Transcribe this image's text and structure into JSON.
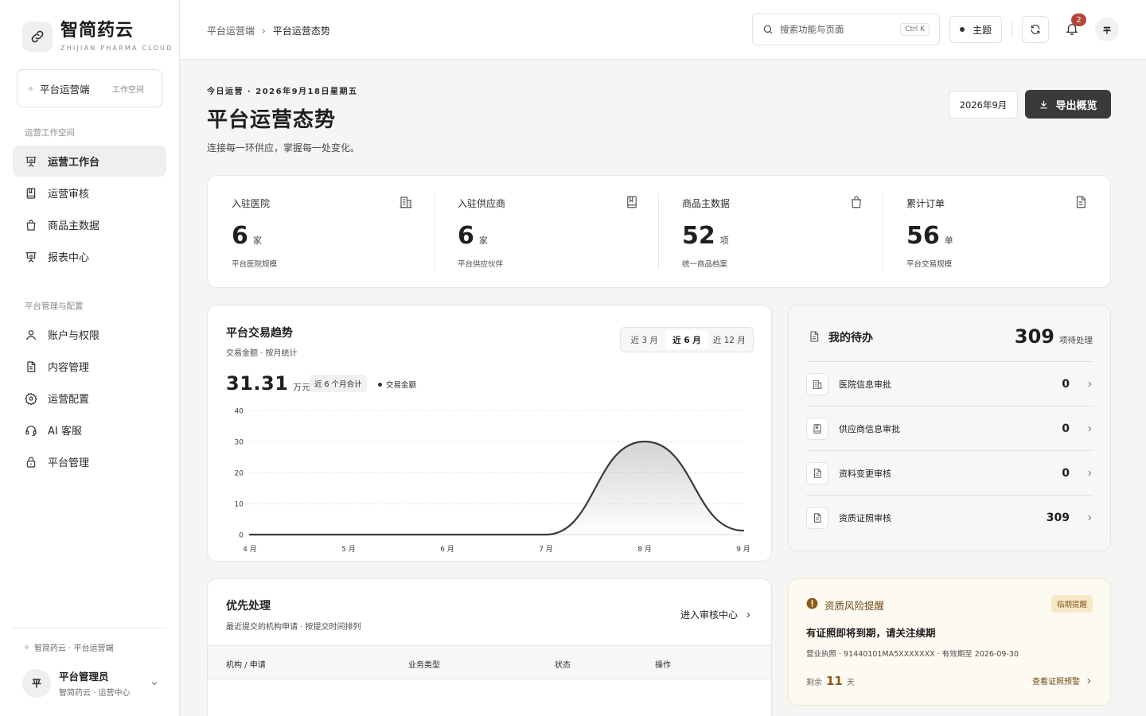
{
  "brand": {
    "name": "智简药云",
    "sub": "ZHIJIAN PHARMA CLOUD"
  },
  "workspace": {
    "label": "平台运营端",
    "tag": "工作空间"
  },
  "nav": {
    "group1": "运营工作空间",
    "group2": "平台管理与配置",
    "items": [
      {
        "label": "运营工作台",
        "icon": "presentation-icon",
        "active": true
      },
      {
        "label": "运营审核",
        "icon": "book-icon"
      },
      {
        "label": "商品主数据",
        "icon": "shopping-bag-icon"
      },
      {
        "label": "报表中心",
        "icon": "presentation-icon"
      },
      {
        "label": "账户与权限",
        "icon": "user-icon"
      },
      {
        "label": "内容管理",
        "icon": "document-icon"
      },
      {
        "label": "运营配置",
        "icon": "gear-icon"
      },
      {
        "label": "AI 客服",
        "icon": "headset-icon"
      },
      {
        "label": "平台管理",
        "icon": "lock-icon"
      }
    ]
  },
  "sidebar_footer": "智简药云 · 平台运营端",
  "user": {
    "avatar": "平",
    "name": "平台管理员",
    "sub": "智简药云 · 运营中心"
  },
  "topbar": {
    "breadcrumb": [
      "平台运营端",
      "平台运营态势"
    ],
    "breadcrumb_sep": "›",
    "search_placeholder": "搜索功能与页面",
    "search_shortcut": "Ctrl K",
    "theme_label": "主题",
    "notification_count": "2",
    "avatar": "平"
  },
  "header": {
    "eyebrow": "今日运营 · 2026年9月18日星期五",
    "title": "平台运营态势",
    "tagline": "连接每一环供应，掌握每一处变化。",
    "month": "2026年9月",
    "export_label": "导出概览"
  },
  "stats": [
    {
      "label": "入驻医院",
      "value": "6",
      "unit": "家",
      "sub": "平台医院规模",
      "icon": "building-icon"
    },
    {
      "label": "入驻供应商",
      "value": "6",
      "unit": "家",
      "sub": "平台供应伙伴",
      "icon": "book-icon"
    },
    {
      "label": "商品主数据",
      "value": "52",
      "unit": "项",
      "sub": "统一商品档案",
      "icon": "shopping-bag-icon"
    },
    {
      "label": "累计订单",
      "value": "56",
      "unit": "单",
      "sub": "平台交易规模",
      "icon": "document-icon"
    }
  ],
  "trend": {
    "title": "平台交易趋势",
    "subtitle": "交易金额 · 按月统计",
    "ranges": [
      "近 3 月",
      "近 6 月",
      "近 12 月"
    ],
    "active_range": 1,
    "total": "31.31",
    "total_unit": "万元",
    "total_tag": "近 6 个月合计",
    "legend": "交易金额"
  },
  "chart_data": {
    "type": "area",
    "x": [
      "4 月",
      "5 月",
      "6 月",
      "7 月",
      "8 月",
      "9 月"
    ],
    "series": [
      {
        "name": "交易金额",
        "values": [
          0,
          0,
          0,
          0,
          30,
          1.3
        ]
      }
    ],
    "ylim": [
      0,
      40
    ],
    "yticks": [
      0,
      10,
      20,
      30,
      40
    ],
    "grid": true,
    "color": "#3a3a3a"
  },
  "todo": {
    "title": "我的待办",
    "count": "309",
    "count_label": "项待处理",
    "items": [
      {
        "label": "医院信息审批",
        "value": "0",
        "icon": "building-icon"
      },
      {
        "label": "供应商信息审批",
        "value": "0",
        "icon": "book-icon"
      },
      {
        "label": "资料变更审核",
        "value": "0",
        "icon": "document-icon"
      },
      {
        "label": "资质证照审核",
        "value": "309",
        "icon": "document-icon"
      }
    ]
  },
  "priority": {
    "title": "优先处理",
    "subtitle": "最近提交的机构申请 · 按提交时间排列",
    "link": "进入审核中心",
    "columns": [
      "机构 / 申请",
      "业务类型",
      "状态",
      "操作"
    ]
  },
  "risk": {
    "title": "资质风险提醒",
    "tag": "临期提醒",
    "headline": "有证照即将到期，请关注续期",
    "detail": "营业执照 · 91440101MA5XXXXXXX · 有效期至 2026-09-30",
    "remain_prefix": "剩余",
    "remain_days": "11",
    "remain_suffix": "天",
    "link": "查看证照预警"
  },
  "colors": {
    "accent": "#3a3a3a",
    "badge": "#b3473a",
    "warning": "#8a5a16",
    "warning_bg": "#fdfaf2"
  }
}
